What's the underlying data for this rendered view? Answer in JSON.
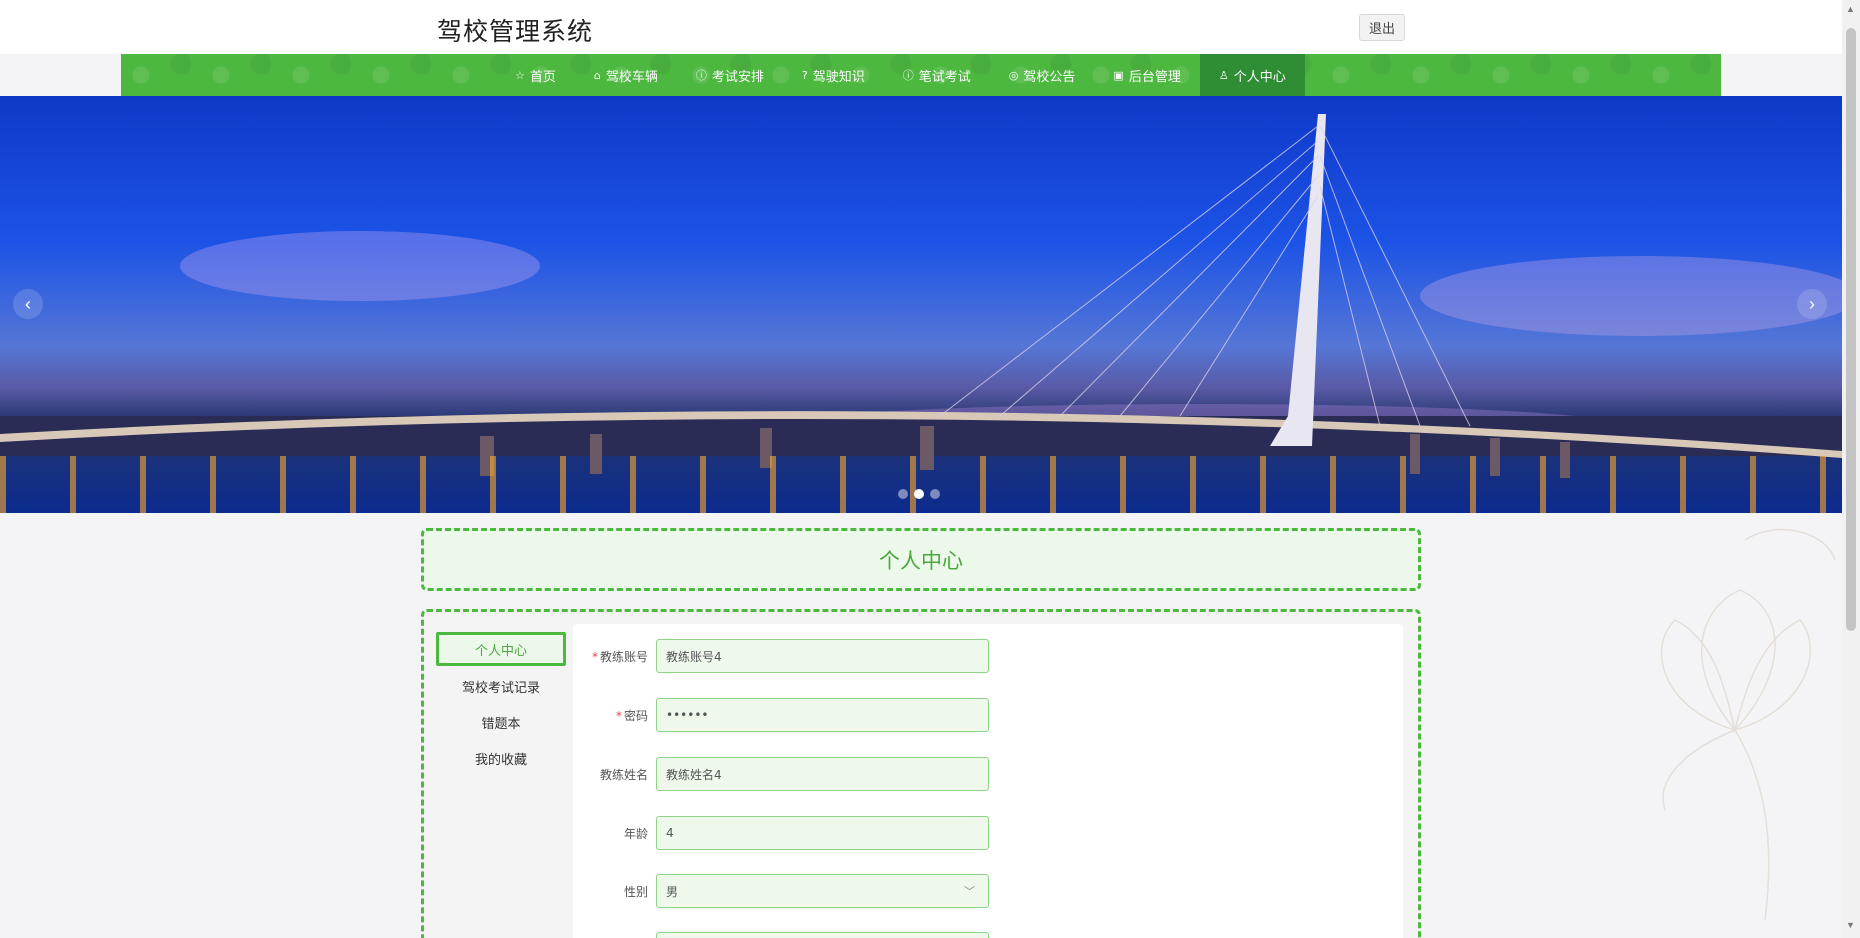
{
  "header": {
    "title": "驾校管理系统",
    "logout_label": "退出"
  },
  "nav": {
    "items": [
      {
        "label": "首页",
        "icon": "star-icon",
        "glyph": "☆"
      },
      {
        "label": "驾校车辆",
        "icon": "home-icon",
        "glyph": "⌂"
      },
      {
        "label": "考试安排",
        "icon": "info-icon",
        "glyph": "ⓘ"
      },
      {
        "label": "驾驶知识",
        "icon": "question-icon",
        "glyph": "?"
      },
      {
        "label": "笔试考试",
        "icon": "info-icon",
        "glyph": "ⓘ"
      },
      {
        "label": "驾校公告",
        "icon": "globe-icon",
        "glyph": "◎"
      },
      {
        "label": "后台管理",
        "icon": "briefcase-icon",
        "glyph": "▣"
      },
      {
        "label": "个人中心",
        "icon": "user-icon",
        "glyph": "♙"
      }
    ],
    "active_index": 7
  },
  "banner": {
    "prev_glyph": "‹",
    "next_glyph": "›",
    "slide_count": 3,
    "active_slide": 1
  },
  "page_title": "个人中心",
  "side_menu": {
    "items": [
      "个人中心",
      "驾校考试记录",
      "错题本",
      "我的收藏"
    ],
    "active_index": 0
  },
  "form": {
    "fields": [
      {
        "label": "教练账号",
        "required": true,
        "value": "教练账号4",
        "type": "text"
      },
      {
        "label": "密码",
        "required": true,
        "value": "••••••",
        "type": "password"
      },
      {
        "label": "教练姓名",
        "required": false,
        "value": "教练姓名4",
        "type": "text"
      },
      {
        "label": "年龄",
        "required": false,
        "value": "4",
        "type": "text"
      },
      {
        "label": "性别",
        "required": false,
        "value": "男",
        "type": "select"
      }
    ]
  },
  "colors": {
    "accent": "#4db840",
    "accent_dark": "#2f8d34",
    "accent_light": "#ecf8ea",
    "required": "#e34a4a"
  }
}
